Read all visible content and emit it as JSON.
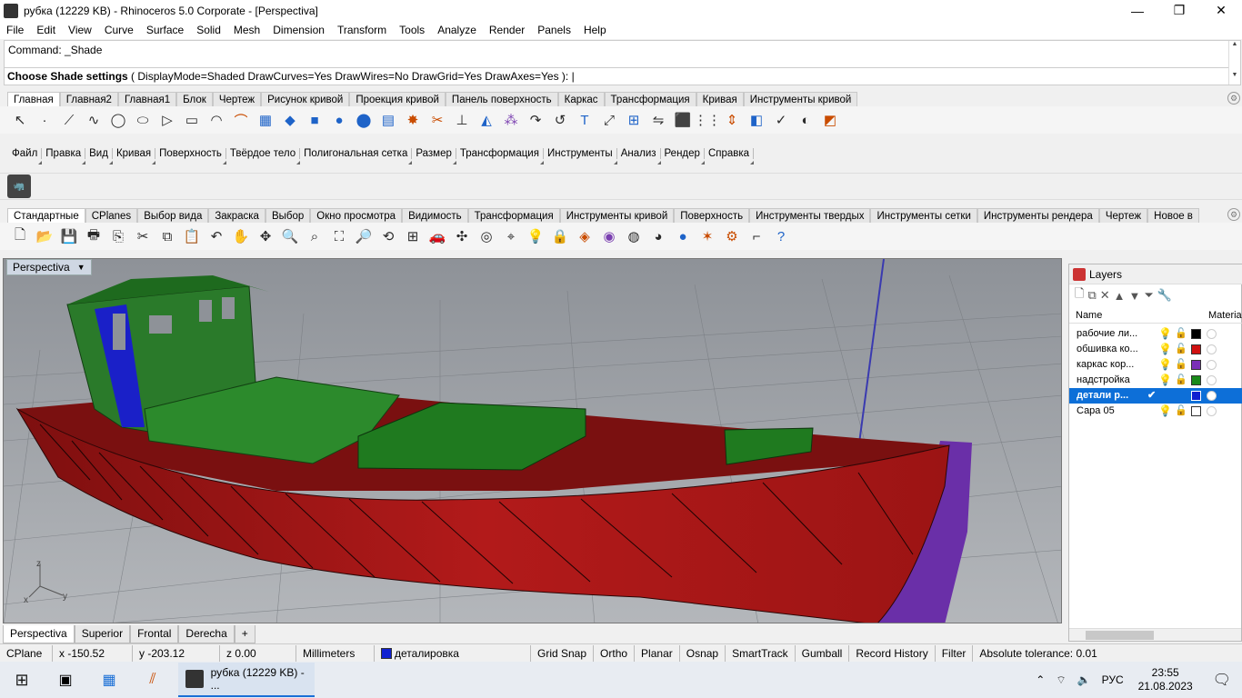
{
  "window": {
    "title": "рубка (12229 KB) - Rhinoceros  5.0 Corporate - [Perspectiva]",
    "minimize": "—",
    "restore": "❐",
    "close": "✕"
  },
  "menu": [
    "File",
    "Edit",
    "View",
    "Curve",
    "Surface",
    "Solid",
    "Mesh",
    "Dimension",
    "Transform",
    "Tools",
    "Analyze",
    "Render",
    "Panels",
    "Help"
  ],
  "command": {
    "history": "Command: _Shade",
    "prompt_bold": "Choose Shade settings",
    "prompt_rest": " ( DisplayMode=Shaded  DrawCurves=Yes  DrawWires=No  DrawGrid=Yes  DrawAxes=Yes ): |"
  },
  "tabs_top": [
    "Главная",
    "Главная2",
    "Главная1",
    "Блок",
    "Чертеж",
    "Рисунок кривой",
    "Проекция кривой",
    "Панель поверхность",
    "Каркас",
    "Трансформация",
    "Кривая",
    "Инструменты кривой"
  ],
  "menu_toolbar": [
    "Файл",
    "Правка",
    "Вид",
    "Кривая",
    "Поверхность",
    "Твёрдое тело",
    "Полигональная сетка",
    "Размер",
    "Трансформация",
    "Инструменты",
    "Анализ",
    "Рендер",
    "Справка"
  ],
  "tabs_bottom": [
    "Стандартные",
    "CPlanes",
    "Выбор вида",
    "Закраска",
    "Выбор",
    "Окно просмотра",
    "Видимость",
    "Трансформация",
    "Инструменты кривой",
    "Поверхность",
    "Инструменты твердых",
    "Инструменты сетки",
    "Инструменты рендера",
    "Чертеж",
    "Новое в"
  ],
  "viewport": {
    "name": "Perspectiva",
    "axis_z": "z",
    "axis_x": "x",
    "axis_y": "y"
  },
  "viewport_tabs": [
    "Perspectiva",
    "Superior",
    "Frontal",
    "Derecha",
    "+"
  ],
  "layers": {
    "panel_title": "Layers",
    "col_name": "Name",
    "col_material": "Material",
    "rows": [
      {
        "name": "рабочие ли...",
        "color": "#000000",
        "current": false
      },
      {
        "name": "обшивка ко...",
        "color": "#d01010",
        "current": false
      },
      {
        "name": "каркас кор...",
        "color": "#7a2fb8",
        "current": false
      },
      {
        "name": "надстройка",
        "color": "#1a8a1a",
        "current": false
      },
      {
        "name": "детали р...",
        "color": "#1020d0",
        "current": true
      },
      {
        "name": "Сара 05",
        "color": "#ffffff",
        "current": false
      }
    ]
  },
  "status": {
    "cplane": "CPlane",
    "x": "x -150.52",
    "y": "y -203.12",
    "z": "z 0.00",
    "units": "Millimeters",
    "layer": "деталировка",
    "layer_color": "#1020d0",
    "grid_snap": "Grid Snap",
    "ortho": "Ortho",
    "planar": "Planar",
    "osnap": "Osnap",
    "smarttrack": "SmartTrack",
    "gumball": "Gumball",
    "record_history": "Record History",
    "filter": "Filter",
    "tolerance": "Absolute tolerance: 0.01"
  },
  "taskbar": {
    "task_label": "рубка (12229 KB) - ...",
    "lang": "РУС",
    "time": "23:55",
    "date": "21.08.2023"
  }
}
